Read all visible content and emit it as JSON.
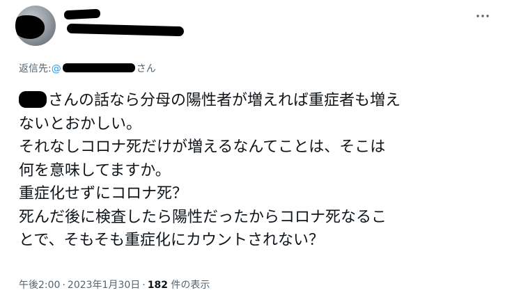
{
  "tweet": {
    "reply_prefix": "返信先:",
    "mention_start": "@",
    "mention_suffix": "さん",
    "lines": [
      "さんの話なら分母の陽性者が増えれば重症者も増え",
      "ないとおかしい。",
      "それなしコロナ死だけが増えるなんてことは、そこは",
      "何を意味してますか。",
      "重症化せずにコロナ死？",
      "死んだ後に検査したら陽性だったからコロナ死なるこ",
      "とで、そもそも重症化にカウントされない？"
    ],
    "time": "午後2:00",
    "separator": "·",
    "date": "2023年1月30日",
    "views_count": "182",
    "views_label": "件の表示"
  },
  "icons": {
    "more": "more-horizontal-icon"
  },
  "colors": {
    "text": "#0f1419",
    "secondary": "#536471",
    "link": "#1d9bf0"
  }
}
